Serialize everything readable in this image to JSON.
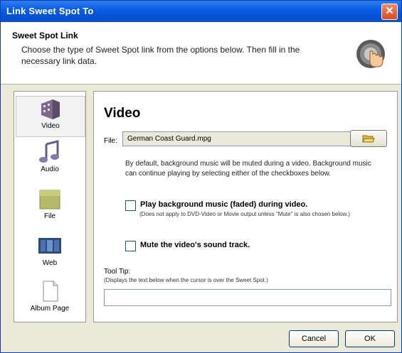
{
  "window": {
    "title": "Link Sweet Spot To"
  },
  "header": {
    "title": "Sweet Spot Link",
    "description": "Choose the type of Sweet Spot link from the options below. Then fill in the necessary link data."
  },
  "sidebar": {
    "items": [
      {
        "label": "Video",
        "icon": "video-icon",
        "selected": true
      },
      {
        "label": "Audio",
        "icon": "music-note-icon",
        "selected": false
      },
      {
        "label": "File",
        "icon": "folder-icon",
        "selected": false
      },
      {
        "label": "Web",
        "icon": "web-icon",
        "selected": false
      },
      {
        "label": "Album Page",
        "icon": "page-icon",
        "selected": false
      }
    ]
  },
  "panel": {
    "title": "Video",
    "file_label": "File:",
    "file_value": "German Coast Guard.mpg",
    "info_text": "By default, background music will be muted during a video. Background music can continue playing by selecting either of the checkboxes below.",
    "checkbox1": {
      "label": "Play background music (faded) during video.",
      "checked": false,
      "note": "(Does not apply to DVD-Video or Movie output unless \"Mute\" is also chosen below.)"
    },
    "checkbox2": {
      "label": "Mute the video's sound track.",
      "checked": false
    },
    "tooltip_label": "Tool Tip:",
    "tooltip_sub": "(Displays the text below when the cursor is over the Sweet Spot.)",
    "tooltip_value": ""
  },
  "buttons": {
    "cancel": "Cancel",
    "ok": "OK"
  },
  "colors": {
    "titlebar": "#0553d6",
    "close": "#d84a20",
    "border": "#7f9db9"
  }
}
